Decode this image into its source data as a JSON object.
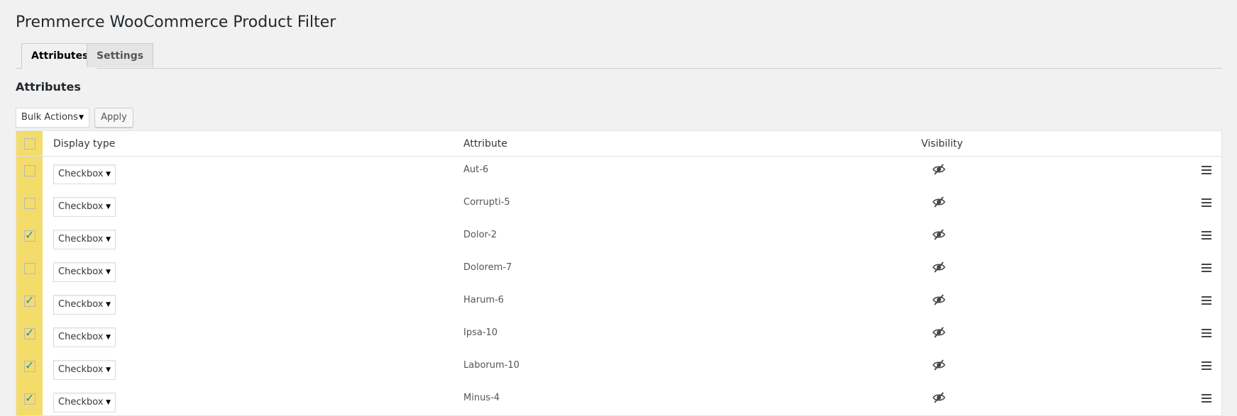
{
  "page": {
    "title": "Premmerce WooCommerce Product Filter"
  },
  "tabs": [
    {
      "label": "Attributes",
      "active": true
    },
    {
      "label": "Settings",
      "active": false
    }
  ],
  "section": {
    "title": "Attributes"
  },
  "bulk": {
    "select_label": "Bulk Actions",
    "apply_label": "Apply"
  },
  "table": {
    "headers": {
      "display_type": "Display type",
      "attribute": "Attribute",
      "visibility": "Visibility"
    },
    "rows": [
      {
        "checked": false,
        "display_type": "Checkbox",
        "attribute": "Aut-6",
        "visibility": "hidden"
      },
      {
        "checked": false,
        "display_type": "Checkbox",
        "attribute": "Corrupti-5",
        "visibility": "hidden"
      },
      {
        "checked": true,
        "display_type": "Checkbox",
        "attribute": "Dolor-2",
        "visibility": "hidden"
      },
      {
        "checked": false,
        "display_type": "Checkbox",
        "attribute": "Dolorem-7",
        "visibility": "hidden"
      },
      {
        "checked": true,
        "display_type": "Checkbox",
        "attribute": "Harum-6",
        "visibility": "hidden"
      },
      {
        "checked": true,
        "display_type": "Checkbox",
        "attribute": "Ipsa-10",
        "visibility": "hidden"
      },
      {
        "checked": true,
        "display_type": "Checkbox",
        "attribute": "Laborum-10",
        "visibility": "hidden"
      },
      {
        "checked": true,
        "display_type": "Checkbox",
        "attribute": "Minus-4",
        "visibility": "hidden"
      }
    ]
  },
  "icons": {
    "visibility": "eye-slash-icon",
    "drag": "drag-handle-icon",
    "caret": "caret-down-icon"
  },
  "colors": {
    "checkbox_column": "#f4dc6b",
    "checkmark": "#1e8cbe",
    "background": "#f1f1f1"
  }
}
